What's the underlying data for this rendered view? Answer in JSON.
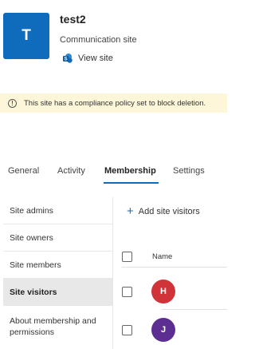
{
  "site": {
    "initial": "T",
    "title": "test2",
    "type": "Communication site",
    "view_site_label": "View site"
  },
  "banner": {
    "icon": "info-icon",
    "icon_glyph": "!",
    "text": "This site has a compliance policy set to block deletion."
  },
  "tabs": [
    {
      "label": "General",
      "active": false
    },
    {
      "label": "Activity",
      "active": false
    },
    {
      "label": "Membership",
      "active": true
    },
    {
      "label": "Settings",
      "active": false
    }
  ],
  "subnav": [
    {
      "label": "Site admins",
      "active": false
    },
    {
      "label": "Site owners",
      "active": false
    },
    {
      "label": "Site members",
      "active": false
    },
    {
      "label": "Site visitors",
      "active": true
    },
    {
      "label": "About membership and permissions",
      "active": false
    }
  ],
  "content": {
    "add_label": "Add site visitors",
    "column_name": "Name",
    "rows": [
      {
        "initial": "H",
        "color": "#d13438"
      },
      {
        "initial": "J",
        "color": "#5c2e91"
      }
    ]
  },
  "colors": {
    "accent": "#0f6cbd",
    "banner_bg": "#fdf6d9"
  }
}
